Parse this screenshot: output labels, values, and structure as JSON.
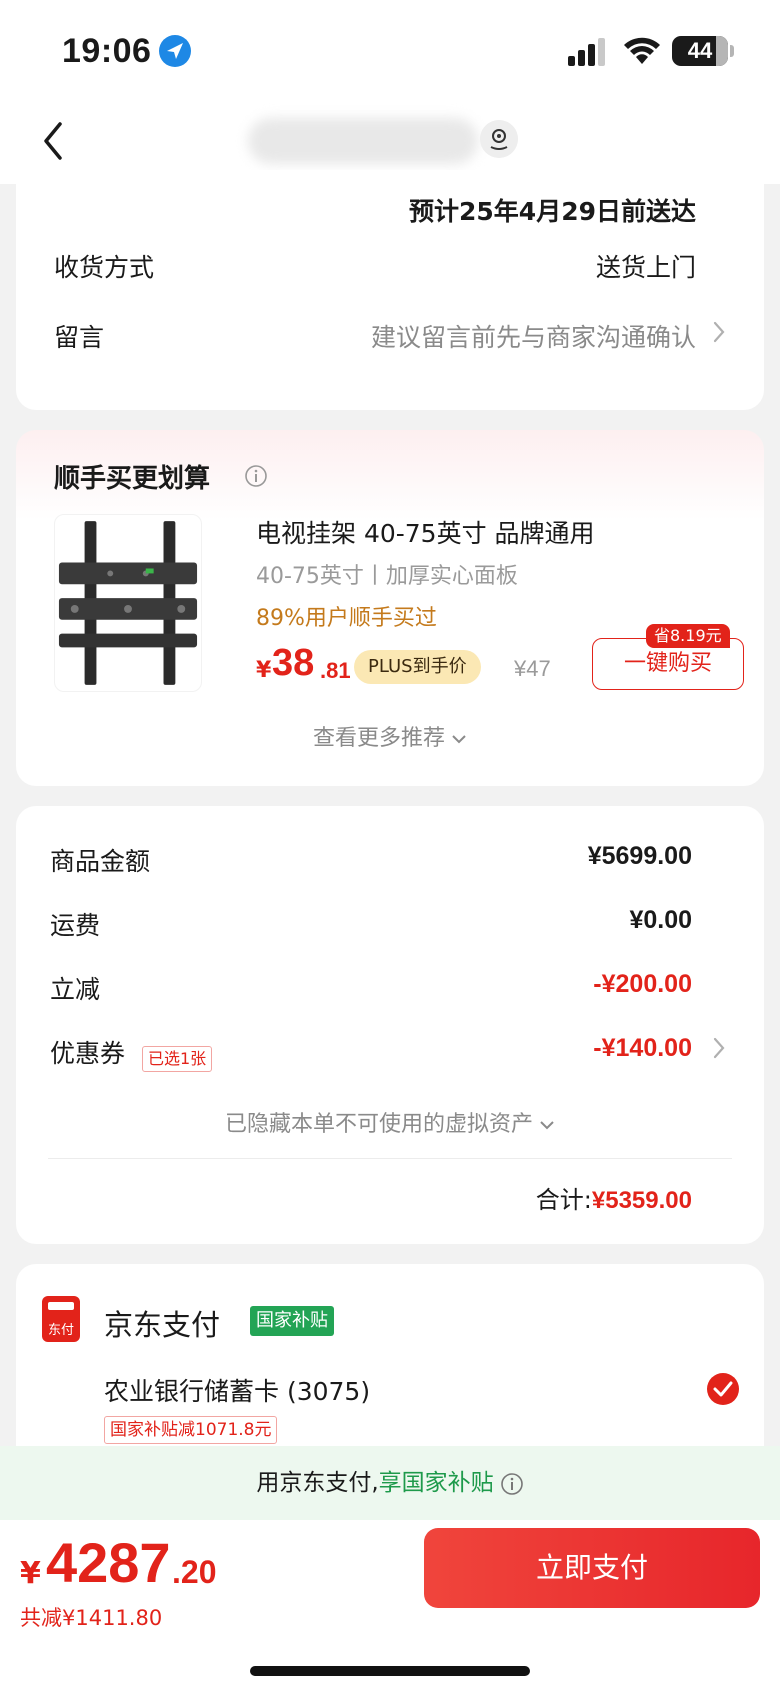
{
  "status_bar": {
    "time": "19:06",
    "battery": "44"
  },
  "delivery": {
    "estimate": "预计25年4月29日前送达",
    "method_label": "收货方式",
    "method_value": "送货上门",
    "message_label": "留言",
    "message_placeholder": "建议留言前先与商家沟通确认"
  },
  "promo": {
    "title": "顺手买更划算",
    "product": {
      "name": "电视挂架 40-75英寸 品牌通用",
      "spec": "40-75英寸丨加厚实心面板",
      "social_proof": "89%用户顺手买过",
      "price_symbol": "¥",
      "price_int": "38",
      "price_dec": ".81",
      "plus_tag": "PLUS到手价",
      "orig_price": "¥47",
      "save_tag": "省8.19元",
      "buy_label": "一键购买"
    },
    "more_label": "查看更多推荐"
  },
  "amounts": {
    "goods_label": "商品金额",
    "goods_value": "¥5699.00",
    "shipping_label": "运费",
    "shipping_value": "¥0.00",
    "discount_label": "立减",
    "discount_value": "-¥200.00",
    "coupon_label": "优惠券",
    "coupon_tag": "已选1张",
    "coupon_value": "-¥140.00",
    "hidden_assets": "已隐藏本单不可使用的虚拟资产",
    "total_label": "合计:",
    "total_value": "¥5359.00"
  },
  "payment": {
    "logo_text": "东付",
    "title": "京东支付",
    "gov_tag": "国家补贴",
    "bank": "农业银行储蓄卡 (3075)",
    "bank_subsidy": "国家补贴减1071.8元"
  },
  "banner": {
    "prefix": "用京东支付,",
    "highlight": "享国家补贴"
  },
  "bottom": {
    "price_symbol": "¥",
    "price_int": "4287",
    "price_dec": ".20",
    "saving": "共减¥1411.80",
    "pay_label": "立即支付"
  },
  "colors": {
    "accent": "#e2231a",
    "green": "#23a455",
    "plus_bg": "#fbe8b4"
  },
  "icons": [
    "location-arrow-icon",
    "signal-icon",
    "wifi-icon",
    "back-icon",
    "store-location-icon",
    "chevron-right-icon",
    "info-icon",
    "chevron-down-icon",
    "check-circle-icon"
  ]
}
